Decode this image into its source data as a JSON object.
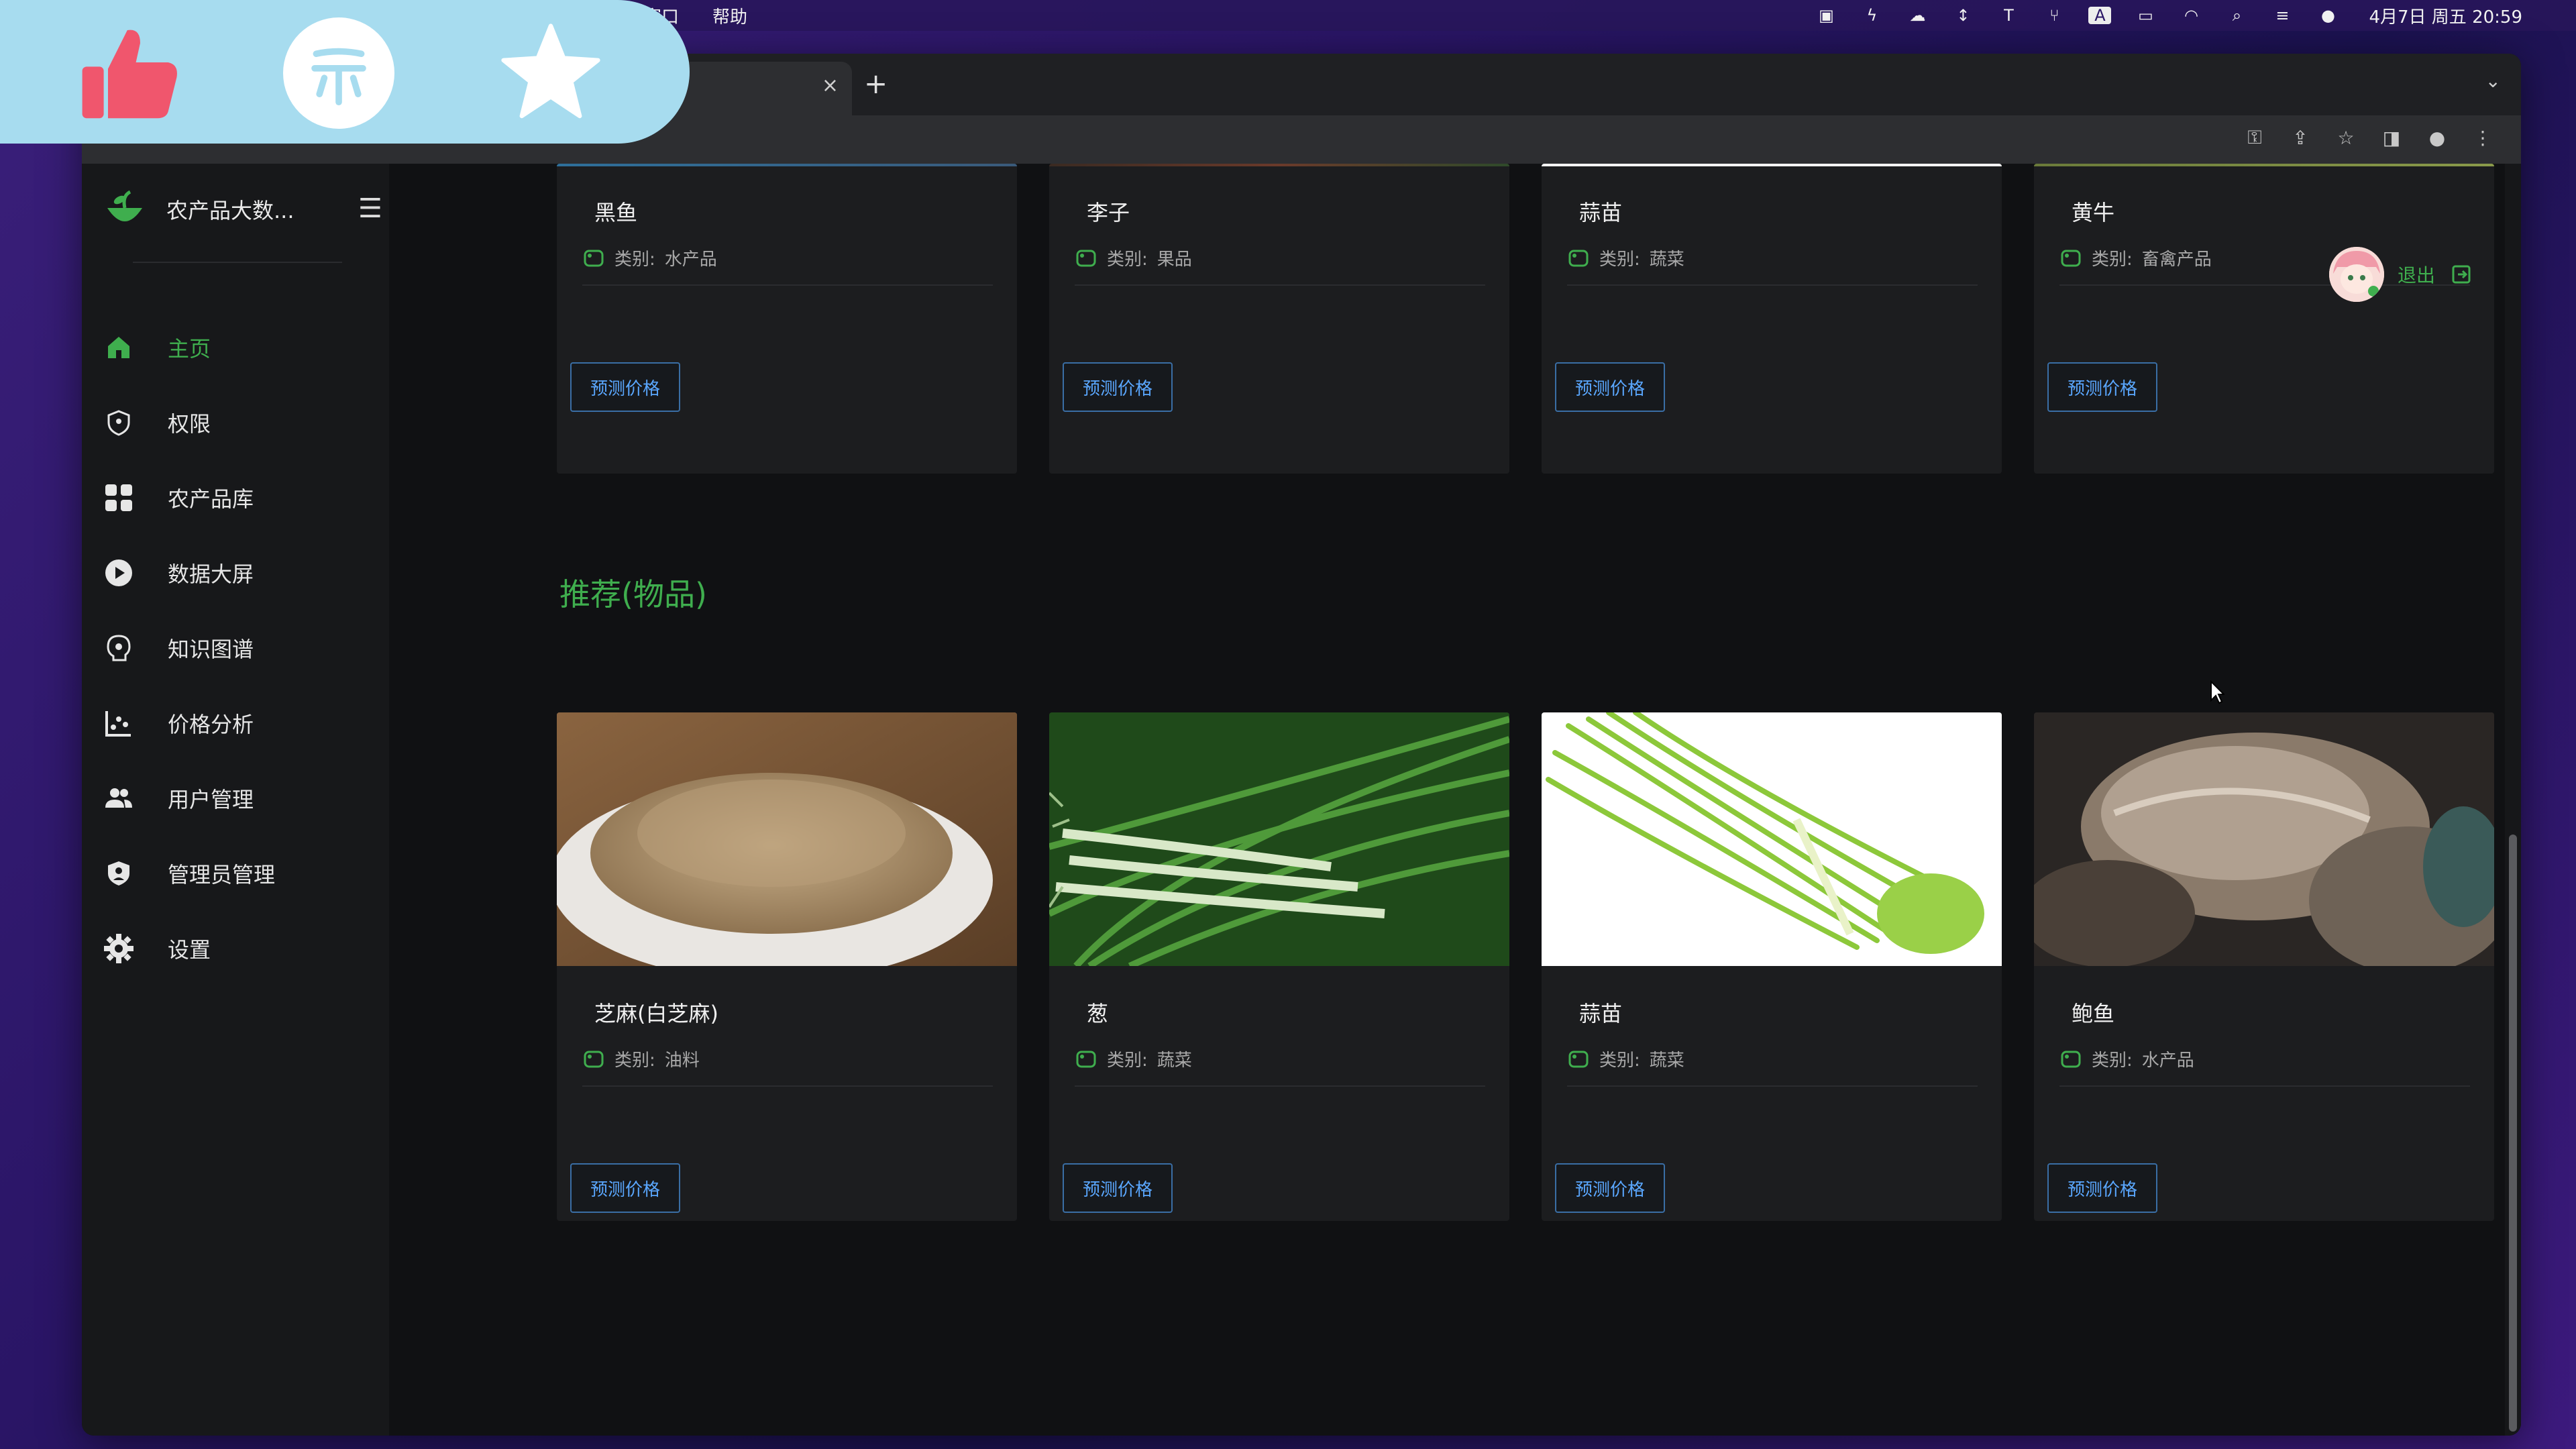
{
  "menubar": {
    "menus": [
      "窗口",
      "帮助"
    ],
    "status_icons": [
      "camera-icon",
      "lightning-icon",
      "cloud-icon",
      "arrow-icon",
      "text-icon",
      "fork-icon",
      "input-a-icon",
      "battery-icon",
      "wifi-icon",
      "search-icon",
      "control-center-icon",
      "siri-icon"
    ],
    "clock": "4月7日 周五 20:59"
  },
  "browser": {
    "tab_close": "×",
    "new_tab": "+",
    "tab_menu": "⌄",
    "toolbar_icons": [
      "key-icon",
      "share-icon",
      "bookmark-star-icon",
      "sidebar-icon",
      "profile-icon",
      "more-icon"
    ]
  },
  "sidebar": {
    "brand": "农产品大数...",
    "items": [
      {
        "label": "主页",
        "icon": "home-icon"
      },
      {
        "label": "权限",
        "icon": "shield-icon"
      },
      {
        "label": "农产品库",
        "icon": "grid-icon"
      },
      {
        "label": "数据大屏",
        "icon": "play-icon"
      },
      {
        "label": "知识图谱",
        "icon": "brain-icon"
      },
      {
        "label": "价格分析",
        "icon": "chart-icon"
      },
      {
        "label": "用户管理",
        "icon": "users-icon"
      },
      {
        "label": "管理员管理",
        "icon": "admin-shield-icon"
      },
      {
        "label": "设置",
        "icon": "gear-icon"
      }
    ]
  },
  "header": {
    "logout": "退出"
  },
  "top_row": [
    {
      "title": "黑鱼",
      "category_label": "类别:",
      "category": "水产品",
      "button": "预测价格"
    },
    {
      "title": "李子",
      "category_label": "类别:",
      "category": "果品",
      "button": "预测价格"
    },
    {
      "title": "蒜苗",
      "category_label": "类别:",
      "category": "蔬菜",
      "button": "预测价格"
    },
    {
      "title": "黄牛",
      "category_label": "类别:",
      "category": "畜禽产品",
      "button": "预测价格"
    }
  ],
  "recommend": {
    "title": "推荐(物品)",
    "items": [
      {
        "title": "芝麻(白芝麻)",
        "category_label": "类别:",
        "category": "油料",
        "button": "预测价格",
        "image": "sesame-photo"
      },
      {
        "title": "葱",
        "category_label": "类别:",
        "category": "蔬菜",
        "button": "预测价格",
        "image": "scallion-photo"
      },
      {
        "title": "蒜苗",
        "category_label": "类别:",
        "category": "蔬菜",
        "button": "预测价格",
        "image": "garlic-sprout-photo"
      },
      {
        "title": "鲍鱼",
        "category_label": "类别:",
        "category": "水产品",
        "button": "预测价格",
        "image": "abalone-photo"
      }
    ]
  },
  "colors": {
    "accent_green": "#3fae4e",
    "predict_blue": "#5aa7ff",
    "sidebar_bg": "#17181a",
    "content_bg": "#101113"
  }
}
